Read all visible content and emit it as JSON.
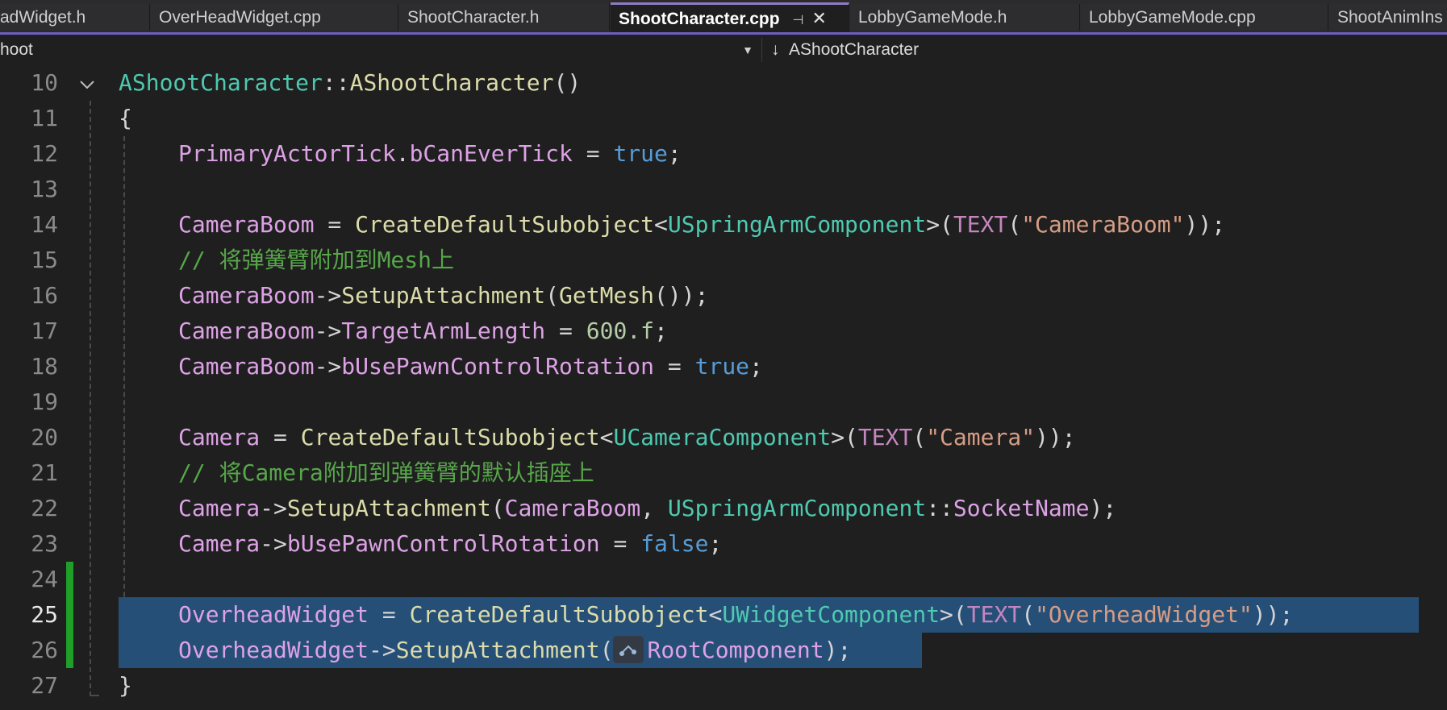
{
  "tabs": [
    {
      "label": "adWidget.h",
      "active": false
    },
    {
      "label": "OverHeadWidget.cpp",
      "active": false
    },
    {
      "label": "ShootCharacter.h",
      "active": false
    },
    {
      "label": "ShootCharacter.cpp",
      "active": true
    },
    {
      "label": "LobbyGameMode.h",
      "active": false
    },
    {
      "label": "LobbyGameMode.cpp",
      "active": false
    },
    {
      "label": "ShootAnimIns",
      "active": false
    }
  ],
  "navbar": {
    "left_scope": "hoot",
    "right_scope": "AShootCharacter"
  },
  "editor": {
    "line_numbers": [
      "10",
      "11",
      "12",
      "13",
      "14",
      "15",
      "16",
      "17",
      "18",
      "19",
      "20",
      "21",
      "22",
      "23",
      "24",
      "25",
      "26",
      "27"
    ],
    "lines": {
      "l10": {
        "a": "AShootCharacter",
        "b": "::",
        "c": "AShootCharacter",
        "d": "()"
      },
      "l11": {
        "a": "{"
      },
      "l12": {
        "a": "PrimaryActorTick",
        "b": ".",
        "c": "bCanEverTick",
        "d": " = ",
        "e": "true",
        "f": ";"
      },
      "l14": {
        "a": "CameraBoom",
        "b": " = ",
        "c": "CreateDefaultSubobject",
        "d": "<",
        "e": "USpringArmComponent",
        "f": ">(",
        "g": "TEXT",
        "h": "(",
        "i": "\"CameraBoom\"",
        "j": "));"
      },
      "l15": {
        "a": "// 将弹簧臂附加到Mesh上"
      },
      "l16": {
        "a": "CameraBoom",
        "b": "->",
        "c": "SetupAttachment",
        "d": "(",
        "e": "GetMesh",
        "f": "());"
      },
      "l17": {
        "a": "CameraBoom",
        "b": "->",
        "c": "TargetArmLength",
        "d": " = ",
        "e": "600.f",
        "f": ";"
      },
      "l18": {
        "a": "CameraBoom",
        "b": "->",
        "c": "bUsePawnControlRotation",
        "d": " = ",
        "e": "true",
        "f": ";"
      },
      "l20": {
        "a": "Camera",
        "b": " = ",
        "c": "CreateDefaultSubobject",
        "d": "<",
        "e": "UCameraComponent",
        "f": ">(",
        "g": "TEXT",
        "h": "(",
        "i": "\"Camera\"",
        "j": "));"
      },
      "l21": {
        "a": "// 将Camera附加到弹簧臂的默认插座上"
      },
      "l22": {
        "a": "Camera",
        "b": "->",
        "c": "SetupAttachment",
        "d": "(",
        "e": "CameraBoom",
        "f": ", ",
        "g": "USpringArmComponent",
        "h": "::",
        "i": "SocketName",
        "j": ");"
      },
      "l23": {
        "a": "Camera",
        "b": "->",
        "c": "bUsePawnControlRotation",
        "d": " = ",
        "e": "false",
        "f": ";"
      },
      "l25": {
        "a": "OverheadWidget",
        "b": " = ",
        "c": "CreateDefaultSubobject",
        "d": "<",
        "e": "UWidgetComponent",
        "f": ">(",
        "g": "TEXT",
        "h": "(",
        "i": "\"OverheadWidget\"",
        "j": "));"
      },
      "l26": {
        "a": "OverheadWidget",
        "b": "->",
        "c": "SetupAttachment",
        "d": "(",
        "e": "RootComponent",
        "f": ");"
      },
      "l27": {
        "a": "}"
      }
    },
    "current_line": "25"
  },
  "colors": {
    "background": "#1f1f1f",
    "selection": "#264f78",
    "modified_marker": "#1f9e28",
    "active_tab_accent": "#8e7cc3"
  },
  "icons": {
    "tab_pin": "pin-icon",
    "tab_close": "close-icon",
    "nav_dropdown": "chevron-down-icon",
    "nav_member": "member-arrow-icon",
    "fold": "fold-chevron-icon",
    "inlay_hint": "parameter-hint-icon"
  }
}
